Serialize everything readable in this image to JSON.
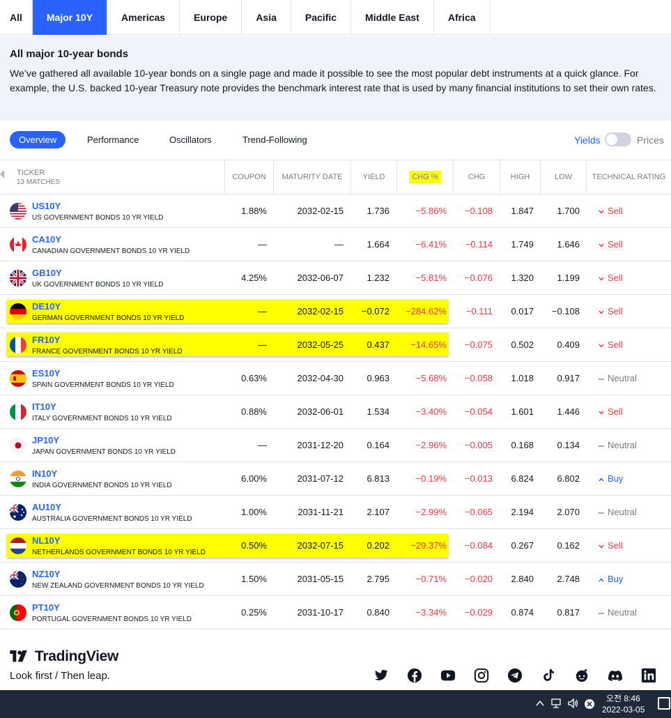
{
  "region_tabs": [
    "All",
    "Major 10Y",
    "Americas",
    "Europe",
    "Asia",
    "Pacific",
    "Middle East",
    "Africa"
  ],
  "info": {
    "title": "All major 10-year bonds",
    "body": "We’ve gathered all available 10-year bonds on a single page and made it possible to see the most popular debt instruments at a quick glance. For example, the U.S. backed 10-year Treasury note provides the benchmark interest rate that is used by many financial institutions to set their own rates."
  },
  "subtabs": [
    "Overview",
    "Performance",
    "Oscillators",
    "Trend-Following"
  ],
  "toggle": {
    "left": "Yields",
    "right": "Prices"
  },
  "table": {
    "headers": {
      "ticker": "TICKER",
      "matches": "13 MATCHES",
      "coupon": "COUPON",
      "maturity": "MATURITY DATE",
      "yield": "YIELD",
      "chg_pct": "CHG %",
      "chg": "CHG",
      "high": "HIGH",
      "low": "LOW",
      "rating": "TECHNICAL RATING"
    },
    "rows": [
      {
        "sym": "US10Y",
        "desc": "US GOVERNMENT BONDS 10 YR YIELD",
        "coupon": "1.88%",
        "maturity": "2032-02-15",
        "yield": "1.736",
        "chg_pct": "−5.86%",
        "chg": "−0.108",
        "high": "1.847",
        "low": "1.700",
        "rating": "Sell",
        "rating_icon": "chevron-down",
        "flag": "us"
      },
      {
        "sym": "CA10Y",
        "desc": "CANADIAN GOVERNMENT BONDS 10 YR YIELD",
        "coupon": "—",
        "maturity": "—",
        "yield": "1.664",
        "chg_pct": "−6.41%",
        "chg": "−0.114",
        "high": "1.749",
        "low": "1.646",
        "rating": "Sell",
        "rating_icon": "chevron-down",
        "flag": "ca"
      },
      {
        "sym": "GB10Y",
        "desc": "UK GOVERNMENT BONDS 10 YR YIELD",
        "coupon": "4.25%",
        "maturity": "2032-06-07",
        "yield": "1.232",
        "chg_pct": "−5.81%",
        "chg": "−0.076",
        "high": "1.320",
        "low": "1.199",
        "rating": "Sell",
        "rating_icon": "chevron-down",
        "flag": "gb"
      },
      {
        "sym": "DE10Y",
        "desc": "GERMAN GOVERNMENT BONDS 10 YR YIELD",
        "coupon": "—",
        "maturity": "2032-02-15",
        "yield": "−0.072",
        "chg_pct": "−284.62%",
        "chg": "−0.111",
        "high": "0.017",
        "low": "−0.108",
        "rating": "Sell",
        "rating_icon": "chevron-down",
        "flag": "de",
        "highlight": true
      },
      {
        "sym": "FR10Y",
        "desc": "FRANCE GOVERNMENT BONDS 10 YR YIELD",
        "coupon": "—",
        "maturity": "2032-05-25",
        "yield": "0.437",
        "chg_pct": "−14.65%",
        "chg": "−0.075",
        "high": "0.502",
        "low": "0.409",
        "rating": "Sell",
        "rating_icon": "chevron-down",
        "flag": "fr",
        "highlight": true
      },
      {
        "sym": "ES10Y",
        "desc": "SPAIN GOVERNMENT BONDS 10 YR YIELD",
        "coupon": "0.63%",
        "maturity": "2032-04-30",
        "yield": "0.963",
        "chg_pct": "−5.68%",
        "chg": "−0.058",
        "high": "1.018",
        "low": "0.917",
        "rating": "Neutral",
        "rating_icon": "dash",
        "flag": "es"
      },
      {
        "sym": "IT10Y",
        "desc": "ITALY GOVERNMENT BONDS 10 YR YIELD",
        "coupon": "0.88%",
        "maturity": "2032-06-01",
        "yield": "1.534",
        "chg_pct": "−3.40%",
        "chg": "−0.054",
        "high": "1.601",
        "low": "1.446",
        "rating": "Sell",
        "rating_icon": "chevron-down",
        "flag": "it"
      },
      {
        "sym": "JP10Y",
        "desc": "JAPAN GOVERNMENT BONDS 10 YR YIELD",
        "coupon": "—",
        "maturity": "2031-12-20",
        "yield": "0.164",
        "chg_pct": "−2.96%",
        "chg": "−0.005",
        "high": "0.168",
        "low": "0.134",
        "rating": "Neutral",
        "rating_icon": "dash",
        "flag": "jp"
      },
      {
        "sym": "IN10Y",
        "desc": "INDIA GOVERNMENT BONDS 10 YR YIELD",
        "coupon": "6.00%",
        "maturity": "2031-07-12",
        "yield": "6.813",
        "chg_pct": "−0.19%",
        "chg": "−0.013",
        "high": "6.824",
        "low": "6.802",
        "rating": "Buy",
        "rating_icon": "chevron-up",
        "flag": "in"
      },
      {
        "sym": "AU10Y",
        "desc": "AUSTRALIA GOVERNMENT BONDS 10 YR YIELD",
        "coupon": "1.00%",
        "maturity": "2031-11-21",
        "yield": "2.107",
        "chg_pct": "−2.99%",
        "chg": "−0.065",
        "high": "2.194",
        "low": "2.070",
        "rating": "Neutral",
        "rating_icon": "dash",
        "flag": "au"
      },
      {
        "sym": "NL10Y",
        "desc": "NETHERLANDS GOVERNMENT BONDS 10 YR YIELD",
        "coupon": "0.50%",
        "maturity": "2032-07-15",
        "yield": "0.202",
        "chg_pct": "−29.37%",
        "chg": "−0.084",
        "high": "0.267",
        "low": "0.162",
        "rating": "Sell",
        "rating_icon": "chevron-down",
        "flag": "nl",
        "highlight": true
      },
      {
        "sym": "NZ10Y",
        "desc": "NEW ZEALAND GOVERNMENT BONDS 10 YR YIELD",
        "coupon": "1.50%",
        "maturity": "2031-05-15",
        "yield": "2.795",
        "chg_pct": "−0.71%",
        "chg": "−0.020",
        "high": "2.840",
        "low": "2.748",
        "rating": "Buy",
        "rating_icon": "chevron-up",
        "flag": "nz"
      },
      {
        "sym": "PT10Y",
        "desc": "PORTUGAL GOVERNMENT BONDS 10 YR YIELD",
        "coupon": "0.25%",
        "maturity": "2031-10-17",
        "yield": "0.840",
        "chg_pct": "−3.34%",
        "chg": "−0.029",
        "high": "0.874",
        "low": "0.817",
        "rating": "Neutral",
        "rating_icon": "dash",
        "flag": "pt"
      }
    ]
  },
  "footer": {
    "brand": "TradingView",
    "slogan": "Look first / Then leap.",
    "social": [
      "twitter-icon",
      "facebook-icon",
      "youtube-icon",
      "instagram-icon",
      "telegram-icon",
      "tiktok-icon",
      "reddit-icon",
      "discord-icon",
      "linkedin-icon"
    ]
  },
  "taskbar": {
    "time": "오전 8:46",
    "date": "2022-03-05"
  },
  "colors": {
    "accent": "#2962ff",
    "negative": "#f23645",
    "highlight": "#ffff00",
    "muted": "#787b86"
  }
}
